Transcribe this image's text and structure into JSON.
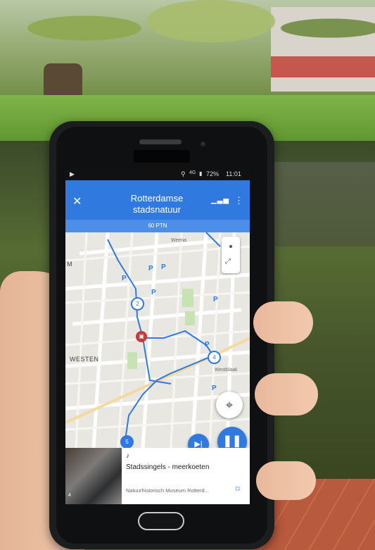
{
  "status_bar": {
    "play_icon": "play-store-icon",
    "network_label": "4G",
    "battery": "72%",
    "time": "11:01"
  },
  "app_bar": {
    "title_line1": "Rotterdamse",
    "title_line2": "stadsnatuur",
    "points": "60 PTN",
    "accent_color": "#2f79df"
  },
  "map": {
    "labels": {
      "westen": "WESTEN",
      "m": "M",
      "weena": "Weena",
      "westblaak": "Westblaak"
    },
    "waypoints": [
      "2",
      "4",
      "5"
    ]
  },
  "player": {
    "next_icon": "skip-next-icon",
    "pause_icon": "pause-icon"
  },
  "card": {
    "title": "Stadssingels - meerkoeten",
    "subtitle": "Natuurhistorisch Museum Rotterd...",
    "thumb_nav": "4"
  }
}
